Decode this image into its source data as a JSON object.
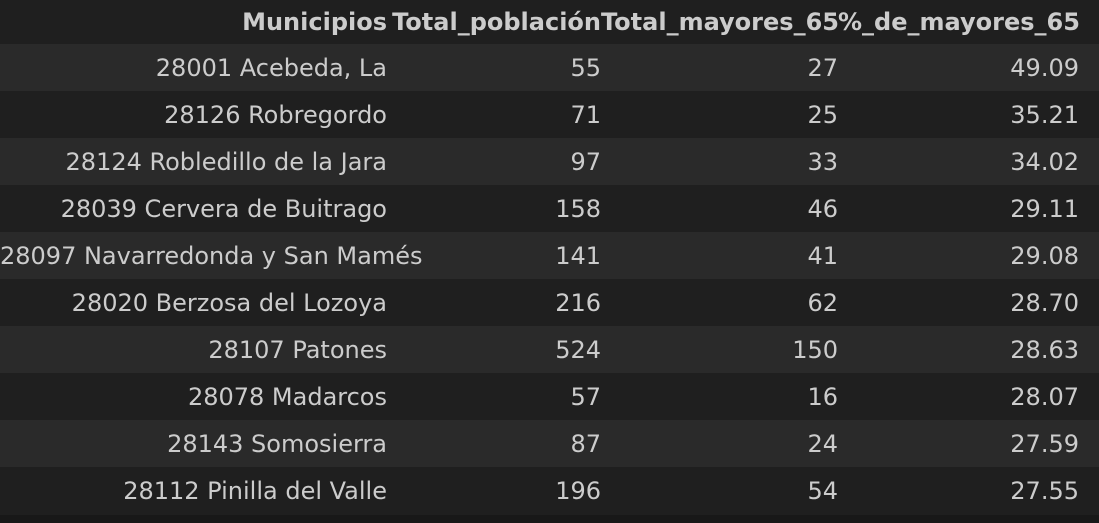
{
  "table": {
    "headers": [
      "Municipios",
      "Total_población",
      "Total_mayores_65",
      "%_de_mayores_65"
    ],
    "rows": [
      [
        "28001 Acebeda, La",
        "55",
        "27",
        "49.09"
      ],
      [
        "28126 Robregordo",
        "71",
        "25",
        "35.21"
      ],
      [
        "28124 Robledillo de la Jara",
        "97",
        "33",
        "34.02"
      ],
      [
        "28039 Cervera de Buitrago",
        "158",
        "46",
        "29.11"
      ],
      [
        "28097 Navarredonda y San Mamés",
        "141",
        "41",
        "29.08"
      ],
      [
        "28020 Berzosa del Lozoya",
        "216",
        "62",
        "28.70"
      ],
      [
        "28107 Patones",
        "524",
        "150",
        "28.63"
      ],
      [
        "28078 Madarcos",
        "57",
        "16",
        "28.07"
      ],
      [
        "28143 Somosierra",
        "87",
        "24",
        "27.59"
      ],
      [
        "28112 Pinilla del Valle",
        "196",
        "54",
        "27.55"
      ]
    ]
  },
  "colors": {
    "background": "#1f1f1f",
    "row_stripe": "#2a2a2a",
    "text": "#cccccc"
  }
}
